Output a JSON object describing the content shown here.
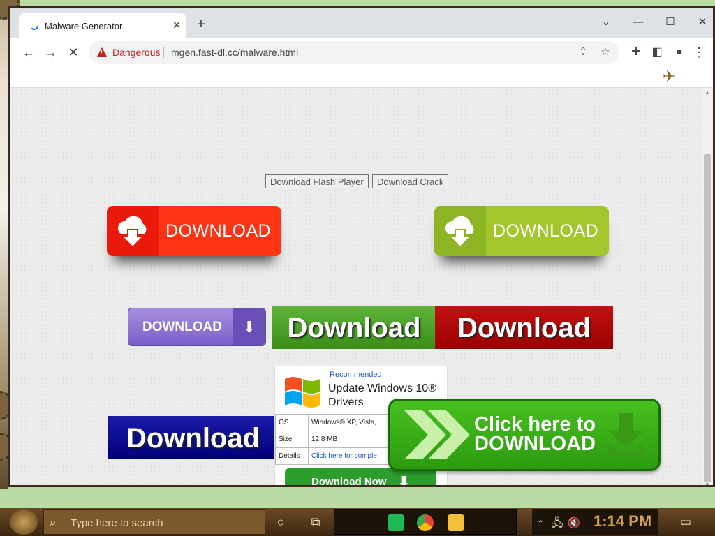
{
  "browser": {
    "tab_title": "Malware Generator",
    "security_label": "Dangerous",
    "url": "mgen.fast-dl.cc/malware.html"
  },
  "page": {
    "small_buttons": [
      "Download Flash Player",
      "Download Crack"
    ],
    "red_big_label": "DOWNLOAD",
    "olive_big_label": "DOWNLOAD",
    "purple_label": "DOWNLOAD",
    "green_label": "Download",
    "red_label": "Download",
    "blue_label": "Download",
    "ad": {
      "recommended": "Recommended",
      "title_line1": "Update Windows 10®",
      "title_line2": "Drivers",
      "rows": [
        {
          "key": "OS",
          "value": "Windows® XP, Vista,"
        },
        {
          "key": "Size",
          "value": "12.8 MB"
        },
        {
          "key": "Details",
          "value": "Click here for comple"
        }
      ],
      "button": "Download Now"
    },
    "click_here_line1": "Click here to",
    "click_here_line2": "DOWNLOAD"
  },
  "taskbar": {
    "search_placeholder": "Type here to search",
    "time": "1:14 PM"
  },
  "colors": {
    "danger": "#c5221f",
    "red_button": "#ff2a10",
    "olive_button": "#9cc42a",
    "taskbar": "#4a3218"
  }
}
